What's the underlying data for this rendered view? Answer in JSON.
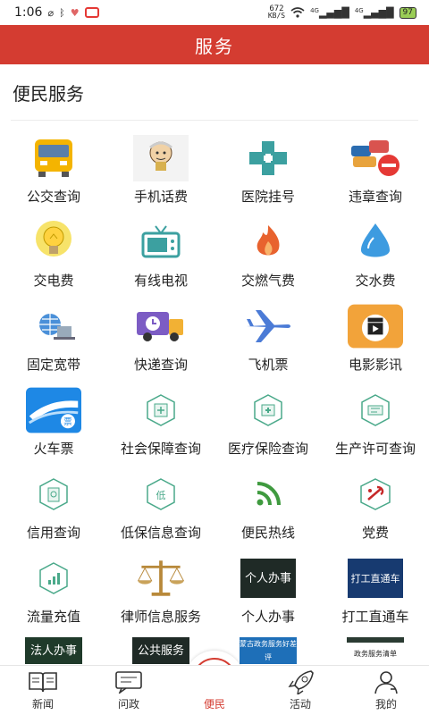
{
  "status_bar": {
    "time": "1:06",
    "net_speed_value": "672",
    "net_speed_unit": "KB/S",
    "sim1": "4G",
    "sim2": "4G",
    "battery": "97"
  },
  "header": {
    "title": "服务"
  },
  "section": {
    "title": "便民服务"
  },
  "services": [
    {
      "label": "公交查询",
      "icon": "bus-icon"
    },
    {
      "label": "手机话费",
      "icon": "phone-bill-icon"
    },
    {
      "label": "医院挂号",
      "icon": "hospital-cross-icon"
    },
    {
      "label": "违章查询",
      "icon": "traffic-violation-icon"
    },
    {
      "label": "交电费",
      "icon": "lightbulb-icon"
    },
    {
      "label": "有线电视",
      "icon": "tv-icon"
    },
    {
      "label": "交燃气费",
      "icon": "flame-icon"
    },
    {
      "label": "交水费",
      "icon": "water-drop-icon"
    },
    {
      "label": "固定宽带",
      "icon": "broadband-laptop-icon"
    },
    {
      "label": "快递查询",
      "icon": "delivery-truck-icon"
    },
    {
      "label": "飞机票",
      "icon": "airplane-icon"
    },
    {
      "label": "电影影讯",
      "icon": "movie-clapper-icon"
    },
    {
      "label": "火车票",
      "icon": "train-ticket-icon"
    },
    {
      "label": "社会保障查询",
      "icon": "social-security-icon"
    },
    {
      "label": "医疗保险查询",
      "icon": "medical-insurance-icon"
    },
    {
      "label": "生产许可查询",
      "icon": "production-license-icon"
    },
    {
      "label": "信用查询",
      "icon": "credit-icon"
    },
    {
      "label": "低保信息查询",
      "icon": "subsistence-allowance-icon"
    },
    {
      "label": "便民热线",
      "icon": "hotline-icon"
    },
    {
      "label": "党费",
      "icon": "party-fee-icon"
    },
    {
      "label": "流量充值",
      "icon": "data-recharge-icon"
    },
    {
      "label": "律师信息服务",
      "icon": "lawyer-scales-icon"
    },
    {
      "label": "个人办事",
      "icon": "personal-affairs-banner"
    },
    {
      "label": "打工直通车",
      "icon": "worker-train-banner"
    }
  ],
  "banner_text": {
    "personal": "个人办事",
    "worker": "打工直通车"
  },
  "partial_row": [
    {
      "text": "法人办事"
    },
    {
      "text": "公共服务"
    },
    {
      "text": "蒙古政务服务好差评"
    },
    {
      "text": "政务服务清单"
    }
  ],
  "tabs": [
    {
      "label": "新闻",
      "icon": "newspaper-icon"
    },
    {
      "label": "问政",
      "icon": "message-icon"
    },
    {
      "label": "便民",
      "icon": "heart-hands-icon",
      "active": true
    },
    {
      "label": "活动",
      "icon": "rocket-icon"
    },
    {
      "label": "我的",
      "icon": "user-icon"
    }
  ],
  "colors": {
    "brand_red": "#d43c31"
  }
}
